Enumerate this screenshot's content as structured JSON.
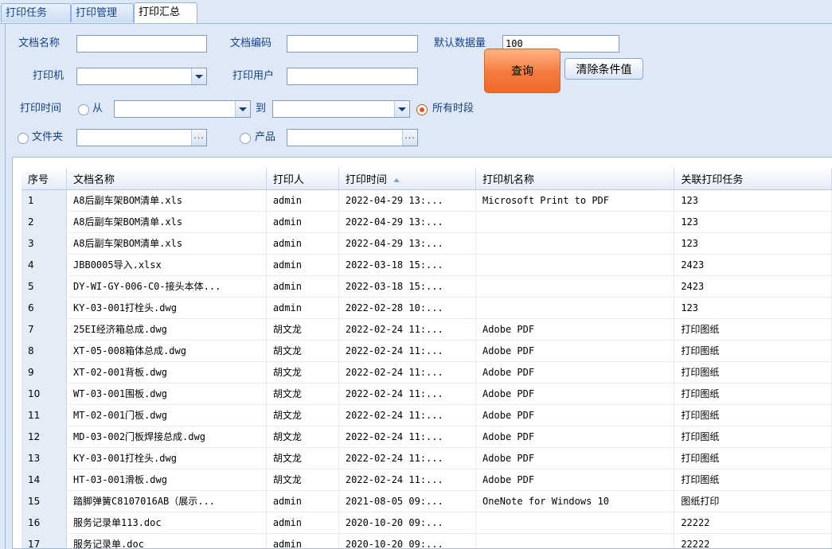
{
  "tabs": [
    {
      "label": "打印任务",
      "active": false
    },
    {
      "label": "打印管理",
      "active": false
    },
    {
      "label": "打印汇总",
      "active": true
    }
  ],
  "filters": {
    "doc_name_label": "文档名称",
    "doc_name_value": "",
    "doc_code_label": "文档编码",
    "doc_code_value": "",
    "default_count_label": "默认数据量",
    "default_count_value": "100",
    "printer_label": "打印机",
    "printer_value": "",
    "print_user_label": "打印用户",
    "print_user_value": "",
    "print_time_label": "打印时间",
    "from_label": "从",
    "to_label": "到",
    "all_periods_label": "所有时段",
    "folder_label": "文件夹",
    "product_label": "产品",
    "time_mode": "all"
  },
  "buttons": {
    "query": "查询",
    "clear": "清除条件值"
  },
  "grid": {
    "columns": [
      "序号",
      "文档名称",
      "打印人",
      "打印时间",
      "打印机名称",
      "关联打印任务"
    ],
    "sorted_column": "打印时间",
    "sort_direction": "asc",
    "rows": [
      [
        "1",
        "A8后副车架BOM清单.xls",
        "admin",
        "2022-04-29 13:...",
        "Microsoft Print to PDF",
        "123"
      ],
      [
        "2",
        "A8后副车架BOM清单.xls",
        "admin",
        "2022-04-29 13:...",
        "",
        "123"
      ],
      [
        "3",
        "A8后副车架BOM清单.xls",
        "admin",
        "2022-04-29 13:...",
        "",
        "123"
      ],
      [
        "4",
        "JBB0005导入.xlsx",
        "admin",
        "2022-03-18 15:...",
        "",
        "2423"
      ],
      [
        "5",
        "DY-WI-GY-006-C0-接头本体...",
        "admin",
        "2022-03-18 15:...",
        "",
        "2423"
      ],
      [
        "6",
        "KY-03-001打栓头.dwg",
        "admin",
        "2022-02-28 10:...",
        "",
        "123"
      ],
      [
        "7",
        "25EI经济箱总成.dwg",
        "胡文龙",
        "2022-02-24 11:...",
        "Adobe PDF",
        "打印图纸"
      ],
      [
        "8",
        "XT-05-008箱体总成.dwg",
        "胡文龙",
        "2022-02-24 11:...",
        "Adobe PDF",
        "打印图纸"
      ],
      [
        "9",
        "XT-02-001背板.dwg",
        "胡文龙",
        "2022-02-24 11:...",
        "Adobe PDF",
        "打印图纸"
      ],
      [
        "10",
        "WT-03-001围板.dwg",
        "胡文龙",
        "2022-02-24 11:...",
        "Adobe PDF",
        "打印图纸"
      ],
      [
        "11",
        "MT-02-001门板.dwg",
        "胡文龙",
        "2022-02-24 11:...",
        "Adobe PDF",
        "打印图纸"
      ],
      [
        "12",
        "MD-03-002门板焊接总成.dwg",
        "胡文龙",
        "2022-02-24 11:...",
        "Adobe PDF",
        "打印图纸"
      ],
      [
        "13",
        "KY-03-001打栓头.dwg",
        "胡文龙",
        "2022-02-24 11:...",
        "Adobe PDF",
        "打印图纸"
      ],
      [
        "14",
        "HT-03-001滑板.dwg",
        "胡文龙",
        "2022-02-24 11:...",
        "Adobe PDF",
        "打印图纸"
      ],
      [
        "15",
        "踏脚弹簧C8107016AB（展示...",
        "admin",
        "2021-08-05 09:...",
        "OneNote for Windows 10",
        "图纸打印"
      ],
      [
        "16",
        "服务记录单113.doc",
        "admin",
        "2020-10-20 09:...",
        "",
        "22222"
      ],
      [
        "17",
        "服务记录单.doc",
        "admin",
        "2020-10-20 09:...",
        "",
        "22222"
      ]
    ]
  },
  "colors": {
    "background": "#dfe8f6",
    "label_text": "#15428b",
    "query_button": "#f47a3d",
    "radio_selected": "#e5561e"
  }
}
